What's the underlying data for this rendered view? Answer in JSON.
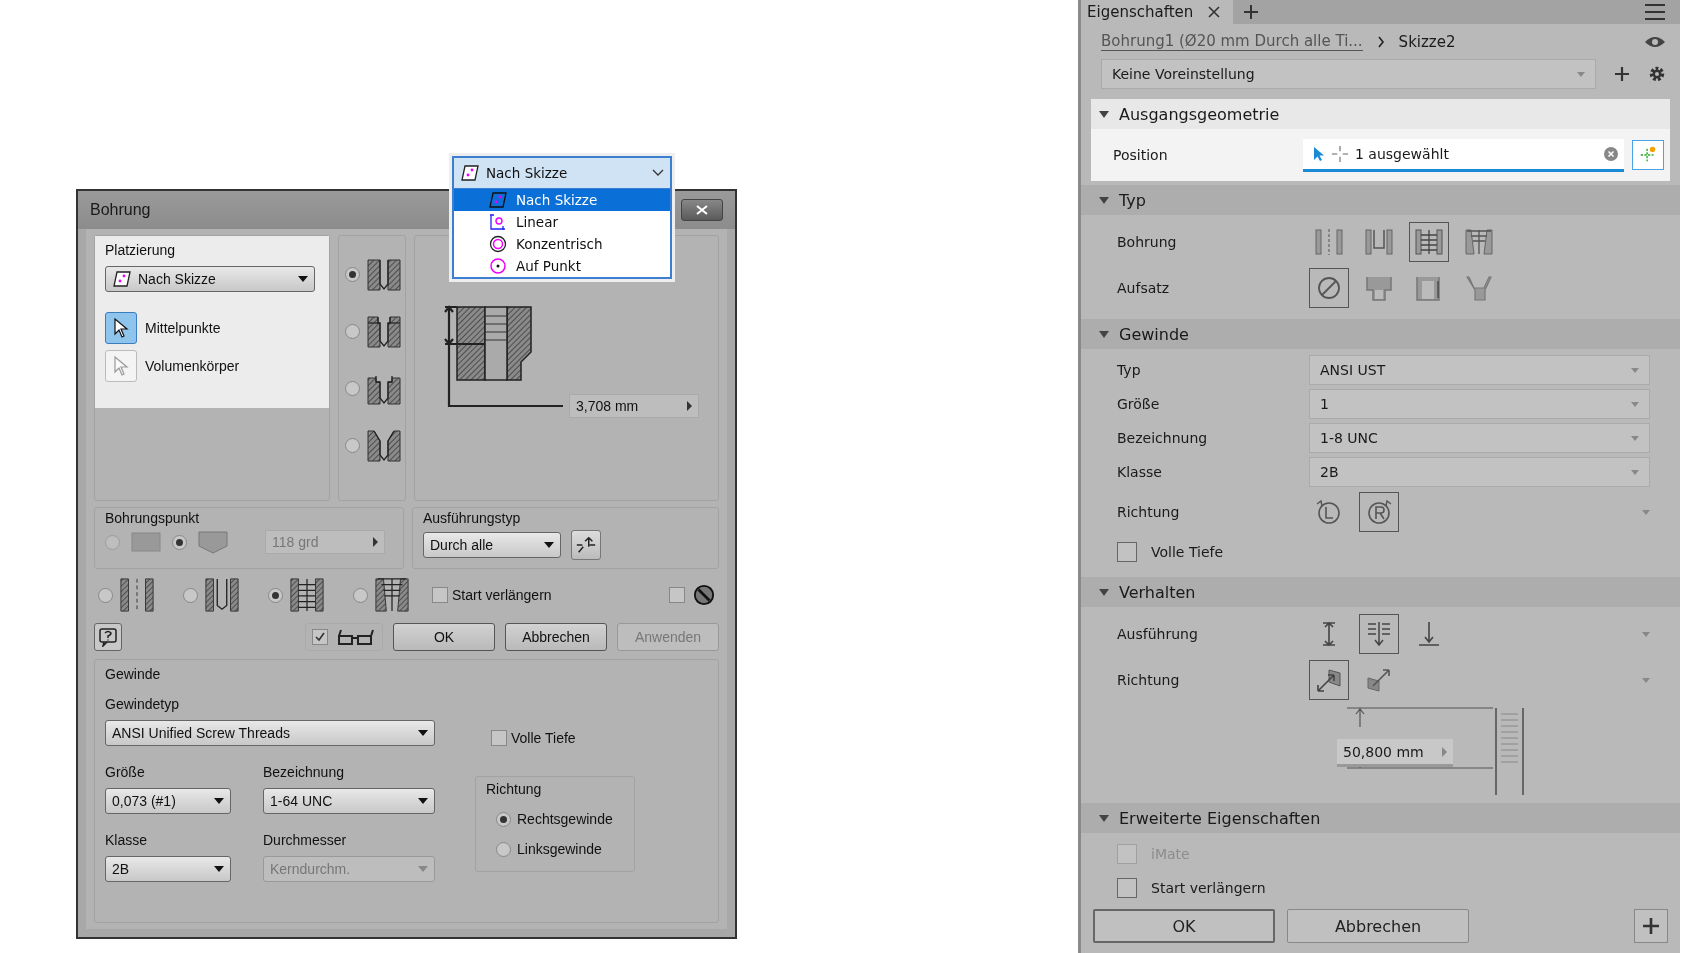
{
  "dialog": {
    "title": "Bohrung",
    "placement": {
      "label": "Platzierung",
      "value": "Nach Skizze",
      "options": [
        {
          "label": "Mittelpunkte",
          "selected": true
        },
        {
          "label": "Volumenkörper",
          "selected": false
        }
      ]
    },
    "seat_types": [
      {
        "kind": "none",
        "selected": true
      },
      {
        "kind": "counterbore",
        "selected": false
      },
      {
        "kind": "spotface",
        "selected": false
      },
      {
        "kind": "countersink",
        "selected": false
      }
    ],
    "depth": "3,708 mm",
    "drill_point": {
      "label": "Bohrungspunkt",
      "options": [
        {
          "kind": "flat",
          "selected": false
        },
        {
          "kind": "angle",
          "selected": true
        }
      ],
      "angle": "118 grd"
    },
    "termination": {
      "label": "Ausführungstyp",
      "value": "Durch alle"
    },
    "hole_types": [
      {
        "kind": "simple",
        "selected": false
      },
      {
        "kind": "clearance",
        "selected": false
      },
      {
        "kind": "tapped",
        "selected": true
      },
      {
        "kind": "taper",
        "selected": false
      }
    ],
    "start_extend": {
      "label": "Start verlängern",
      "checked": false
    },
    "extra_option": {
      "checked": false
    },
    "preview": {
      "checked": true
    },
    "buttons": [
      {
        "label": "OK",
        "disabled": false
      },
      {
        "label": "Abbrechen",
        "disabled": false
      },
      {
        "label": "Anwenden",
        "disabled": true
      }
    ],
    "thread": {
      "label": "Gewinde",
      "type_label": "Gewindetyp",
      "type": "ANSI Unified Screw Threads",
      "full_depth": {
        "label": "Volle Tiefe",
        "checked": false
      },
      "size_label": "Größe",
      "size": "0,073 (#1)",
      "designation_label": "Bezeichnung",
      "designation": "1-64 UNC",
      "class_label": "Klasse",
      "class": "2B",
      "diameter_label": "Durchmesser",
      "diameter": "Kerndurchm.",
      "diameter_disabled": true,
      "direction_label": "Richtung",
      "directions": [
        {
          "label": "Rechtsgewinde",
          "selected": true
        },
        {
          "label": "Linksgewinde",
          "selected": false
        }
      ]
    }
  },
  "dropdown": {
    "value": "Nach Skizze",
    "items": [
      {
        "label": "Nach Skizze",
        "kind": "sketch",
        "selected": true
      },
      {
        "label": "Linear",
        "kind": "linear",
        "selected": false
      },
      {
        "label": "Konzentrisch",
        "kind": "concentric",
        "selected": false
      },
      {
        "label": "Auf Punkt",
        "kind": "point",
        "selected": false
      }
    ]
  },
  "panel": {
    "tab": "Eigenschaften",
    "breadcrumb": "Bohrung1 (Ø20 mm Durch alle Ti...",
    "current": "Skizze2",
    "preset": "Keine Voreinstellung",
    "sections": [
      {
        "title": "Ausgangsgeometrie",
        "expanded": true,
        "highlighted": true,
        "rows": [
          {
            "kind": "selection",
            "label": "Position",
            "value": "1 ausgewählt"
          }
        ]
      },
      {
        "title": "Typ",
        "expanded": true,
        "highlighted": false,
        "rows": [
          {
            "kind": "icons",
            "label": "Bohrung",
            "menu": false,
            "icons": [
              {
                "kind": "simple",
                "selected": false
              },
              {
                "kind": "clearance",
                "selected": false
              },
              {
                "kind": "tapped",
                "selected": true
              },
              {
                "kind": "taper",
                "selected": false
              }
            ]
          },
          {
            "kind": "icons",
            "label": "Aufsatz",
            "menu": false,
            "icons": [
              {
                "kind": "none",
                "selected": true
              },
              {
                "kind": "counterbore",
                "selected": false
              },
              {
                "kind": "spotface",
                "selected": false
              },
              {
                "kind": "countersink",
                "selected": false
              }
            ]
          }
        ]
      },
      {
        "title": "Gewinde",
        "expanded": true,
        "highlighted": false,
        "rows": [
          {
            "kind": "dropdown",
            "label": "Typ",
            "value": "ANSI UST"
          },
          {
            "kind": "dropdown",
            "label": "Größe",
            "value": "1"
          },
          {
            "kind": "dropdown",
            "label": "Bezeichnung",
            "value": "1-8 UNC"
          },
          {
            "kind": "dropdown",
            "label": "Klasse",
            "value": "2B"
          },
          {
            "kind": "icons",
            "label": "Richtung",
            "menu": true,
            "icons": [
              {
                "kind": "left-hand",
                "selected": false
              },
              {
                "kind": "right-hand",
                "selected": true
              }
            ]
          },
          {
            "kind": "checkbox",
            "label": "Volle Tiefe",
            "checked": false,
            "disabled": false
          }
        ]
      },
      {
        "title": "Verhalten",
        "expanded": true,
        "highlighted": false,
        "rows": [
          {
            "kind": "icons",
            "label": "Ausführung",
            "menu": true,
            "icons": [
              {
                "kind": "distance",
                "selected": false
              },
              {
                "kind": "through",
                "selected": true
              },
              {
                "kind": "to",
                "selected": false
              }
            ]
          },
          {
            "kind": "icons",
            "label": "Richtung",
            "menu": true,
            "icons": [
              {
                "kind": "default",
                "selected": true
              },
              {
                "kind": "flip",
                "selected": false
              }
            ]
          },
          {
            "kind": "dimension",
            "value": "50,800 mm"
          }
        ]
      },
      {
        "title": "Erweiterte Eigenschaften",
        "expanded": true,
        "highlighted": false,
        "rows": [
          {
            "kind": "checkbox",
            "label": "iMate",
            "checked": false,
            "disabled": true
          },
          {
            "kind": "checkbox",
            "label": "Start verlängern",
            "checked": false,
            "disabled": false
          }
        ]
      }
    ],
    "buttons": [
      {
        "label": "OK",
        "primary": true
      },
      {
        "label": "Abbrechen",
        "primary": false
      }
    ]
  }
}
